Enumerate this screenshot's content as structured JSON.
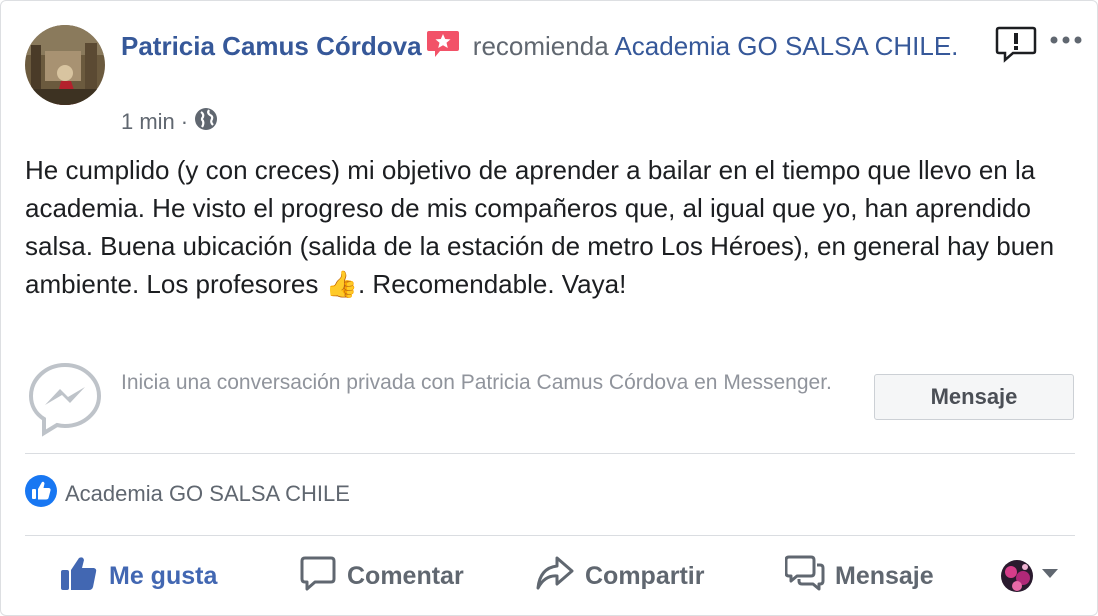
{
  "post": {
    "author": "Patricia Camus Córdova",
    "badge_icon": "recommendation-star-icon",
    "verb": "recomienda",
    "page_name": "Academia GO SALSA CHILE.",
    "time": "1 min",
    "separator": "·",
    "privacy_icon": "globe-icon",
    "body": "He cumplido (y con creces) mi objetivo de aprender a bailar en el tiempo que llevo en la academia. He visto el progreso de mis compañeros que, al igual que yo, han aprendido salsa. Buena ubicación (salida de la estación de metro Los Héroes), en general hay buen ambiente. Los profesores 👍. Recomendable. Vaya!"
  },
  "messenger": {
    "prompt": "Inicia una conversación privada con Patricia Camus Córdova en Messenger.",
    "button_label": "Mensaje"
  },
  "likes": {
    "text": "Academia GO SALSA CHILE"
  },
  "actions": {
    "like": "Me gusta",
    "comment": "Comentar",
    "share": "Compartir",
    "message": "Mensaje"
  },
  "colors": {
    "link": "#365899",
    "like_active": "#4267b2",
    "muted": "#606770",
    "badge": "#f25268"
  }
}
